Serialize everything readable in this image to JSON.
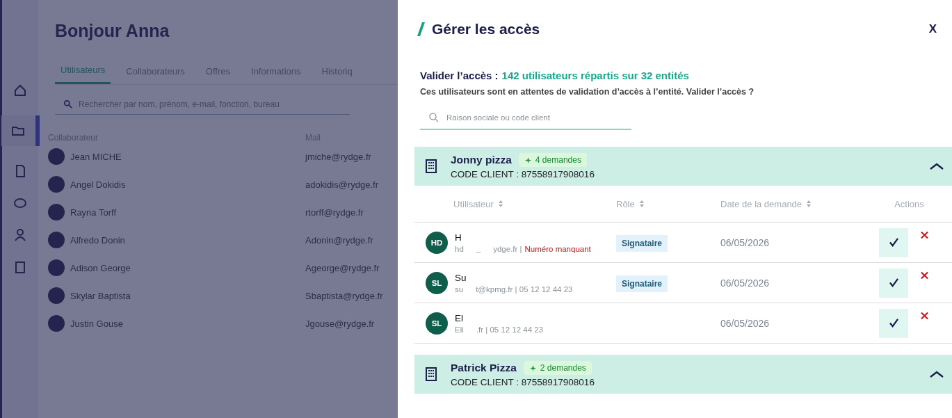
{
  "background": {
    "greeting": "Bonjour Anna",
    "tabs": [
      {
        "label": "Utilisateurs",
        "selected": true
      },
      {
        "label": "Collaborateurs",
        "selected": false
      },
      {
        "label": "Offres",
        "selected": false
      },
      {
        "label": "Informations",
        "selected": false
      },
      {
        "label": "Historiq",
        "selected": false
      }
    ],
    "search": {
      "placeholder": "Rechercher par nom, prénom, e-mail, fonction, bureau"
    },
    "columns": [
      "Collaborateur",
      "Mail"
    ],
    "rows": [
      {
        "name": "Jean MICHE",
        "email": "jmiche@rydge.fr"
      },
      {
        "name": "Angel Dokidis",
        "email": "adokidis@rydge.fr"
      },
      {
        "name": "Rayna Torff",
        "email": "rtorff@rydge.fr"
      },
      {
        "name": "Alfredo Donin",
        "email": "Adonin@rydge.fr"
      },
      {
        "name": "Adison George",
        "email": "Ageorge@rydge.fr"
      },
      {
        "name": "Skylar Baptista",
        "email": "Sbaptista@rydge.fr"
      },
      {
        "name": "Justin Gouse",
        "email": "Jgouse@rydge.fr"
      }
    ]
  },
  "panel": {
    "title": "Gérer les accès",
    "close": "X",
    "intro_label": "Valider l’accès :",
    "intro_count": "142 utilisateurs répartis sur 32 entités",
    "intro_text": "Ces utilisateurs sont en attentes de validation d’accès à l’entité. Valider l’accès ?",
    "search": {
      "placeholder": "Raison sociale ou code client"
    },
    "columns": [
      "Utilisateur",
      "Rôle",
      "Date de la demande",
      "Actions"
    ],
    "groups": [
      {
        "name": "Jonny pizza",
        "badge": "4 demandes",
        "code": "CODE CLIENT : 87558917908016",
        "expanded": true,
        "rows": [
          {
            "initials": "HD",
            "name": "H",
            "contact": [
              "hd",
              "_",
              "ydge.fr |"
            ],
            "warning": "Numéro manquant",
            "role": "Signataire",
            "date": "06/05/2026"
          },
          {
            "initials": "SL",
            "name": "Su",
            "contact": [
              "su",
              "t@kpmg.fr | 05 12 12 44 23"
            ],
            "role": "Signataire",
            "date": "06/05/2026"
          },
          {
            "initials": "SL",
            "name": "El",
            "contact": [
              "Eli",
              ".fr | 05 12 12 44 23"
            ],
            "date": "06/05/2026"
          }
        ]
      },
      {
        "name": "Patrick Pizza",
        "badge": "2 demandes",
        "code": "CODE CLIENT : 87558917908016",
        "expanded": true
      }
    ]
  }
}
